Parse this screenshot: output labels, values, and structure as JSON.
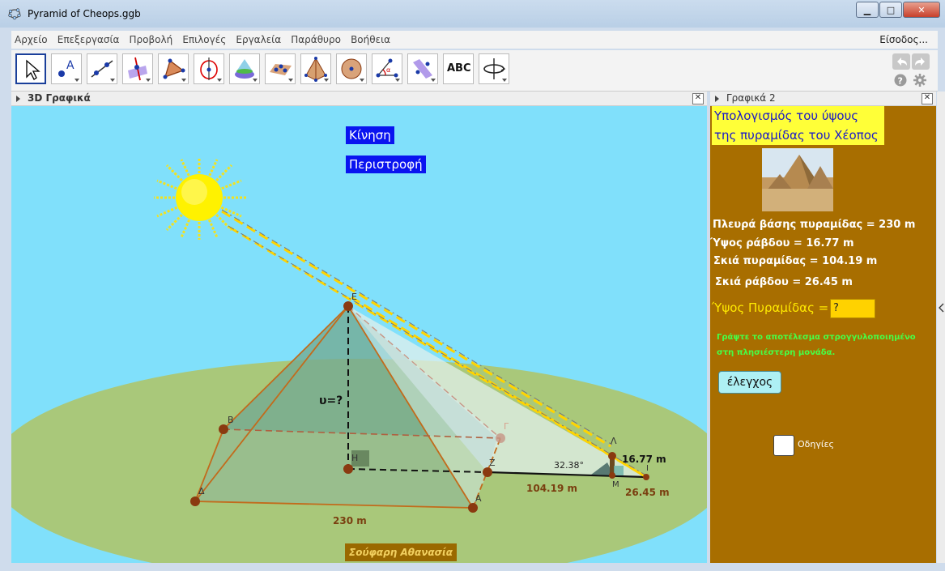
{
  "window": {
    "title": "Pyramid of Cheops.ggb"
  },
  "menu": {
    "items": [
      "Αρχείο",
      "Επεξεργασία",
      "Προβολή",
      "Επιλογές",
      "Εργαλεία",
      "Παράθυρο",
      "Βοήθεια"
    ],
    "signin": "Είσοδος..."
  },
  "toolbar": {
    "tools": [
      "move-tool",
      "point-tool",
      "line-tool",
      "perpendicular-line-tool",
      "polygon-tool",
      "circle-tool",
      "intersect-tool",
      "plane-tool",
      "pyramid-tool",
      "sphere-tool",
      "angle-tool",
      "reflect-tool",
      "text-tool",
      "rotate-view-tool"
    ],
    "text_tool_label": "ABC"
  },
  "panels": {
    "graphics3d": {
      "title": "3D Γραφικά"
    },
    "graphics2": {
      "title": "Γραφικά 2"
    }
  },
  "scene": {
    "buttons": {
      "move": "Κίνηση",
      "rotate": "Περιστροφή"
    },
    "labels": {
      "E": "E",
      "B": "B",
      "Gamma": "Γ",
      "Delta": "Δ",
      "A": "A",
      "H": "H",
      "Z": "Z",
      "Lambda": "Λ",
      "M": "M",
      "I": "I",
      "height": "υ=?",
      "base": "230 m",
      "pyramid_shadow": "104.19 m",
      "rod_shadow": "26.45 m",
      "rod_height": "16.77 m",
      "angle": "32.38°"
    },
    "author": "Σούφαρη Αθανασία"
  },
  "graphics2": {
    "heading_line1": "Υπολογισμός του ύψους",
    "heading_line2": "της πυραμίδας του Χέοπος",
    "facts": [
      "Πλευρά βάσης πυραμίδας = 230 m",
      "Ύψος ράβδου = 16.77 m",
      "Σκιά πυραμίδας = 104.19 m",
      "Σκιά ράβδου = 26.45 m"
    ],
    "height_label": "Ύψος Πυραμίδας =",
    "answer_value": "?",
    "hint_line1": "Γράψτε το αποτέλεσμα στρογγυλοποιημένο",
    "hint_line2": "στη πλησιέστερη μονάδα.",
    "check_button": "έλεγχος",
    "instructions_label": "Οδηγίες"
  },
  "colors": {
    "sky": "#80e0fb",
    "ground": "#a9c87a",
    "panel2_bg": "#a86e00",
    "blue_button": "#0a14f0",
    "heading_bg": "#ffff38"
  }
}
